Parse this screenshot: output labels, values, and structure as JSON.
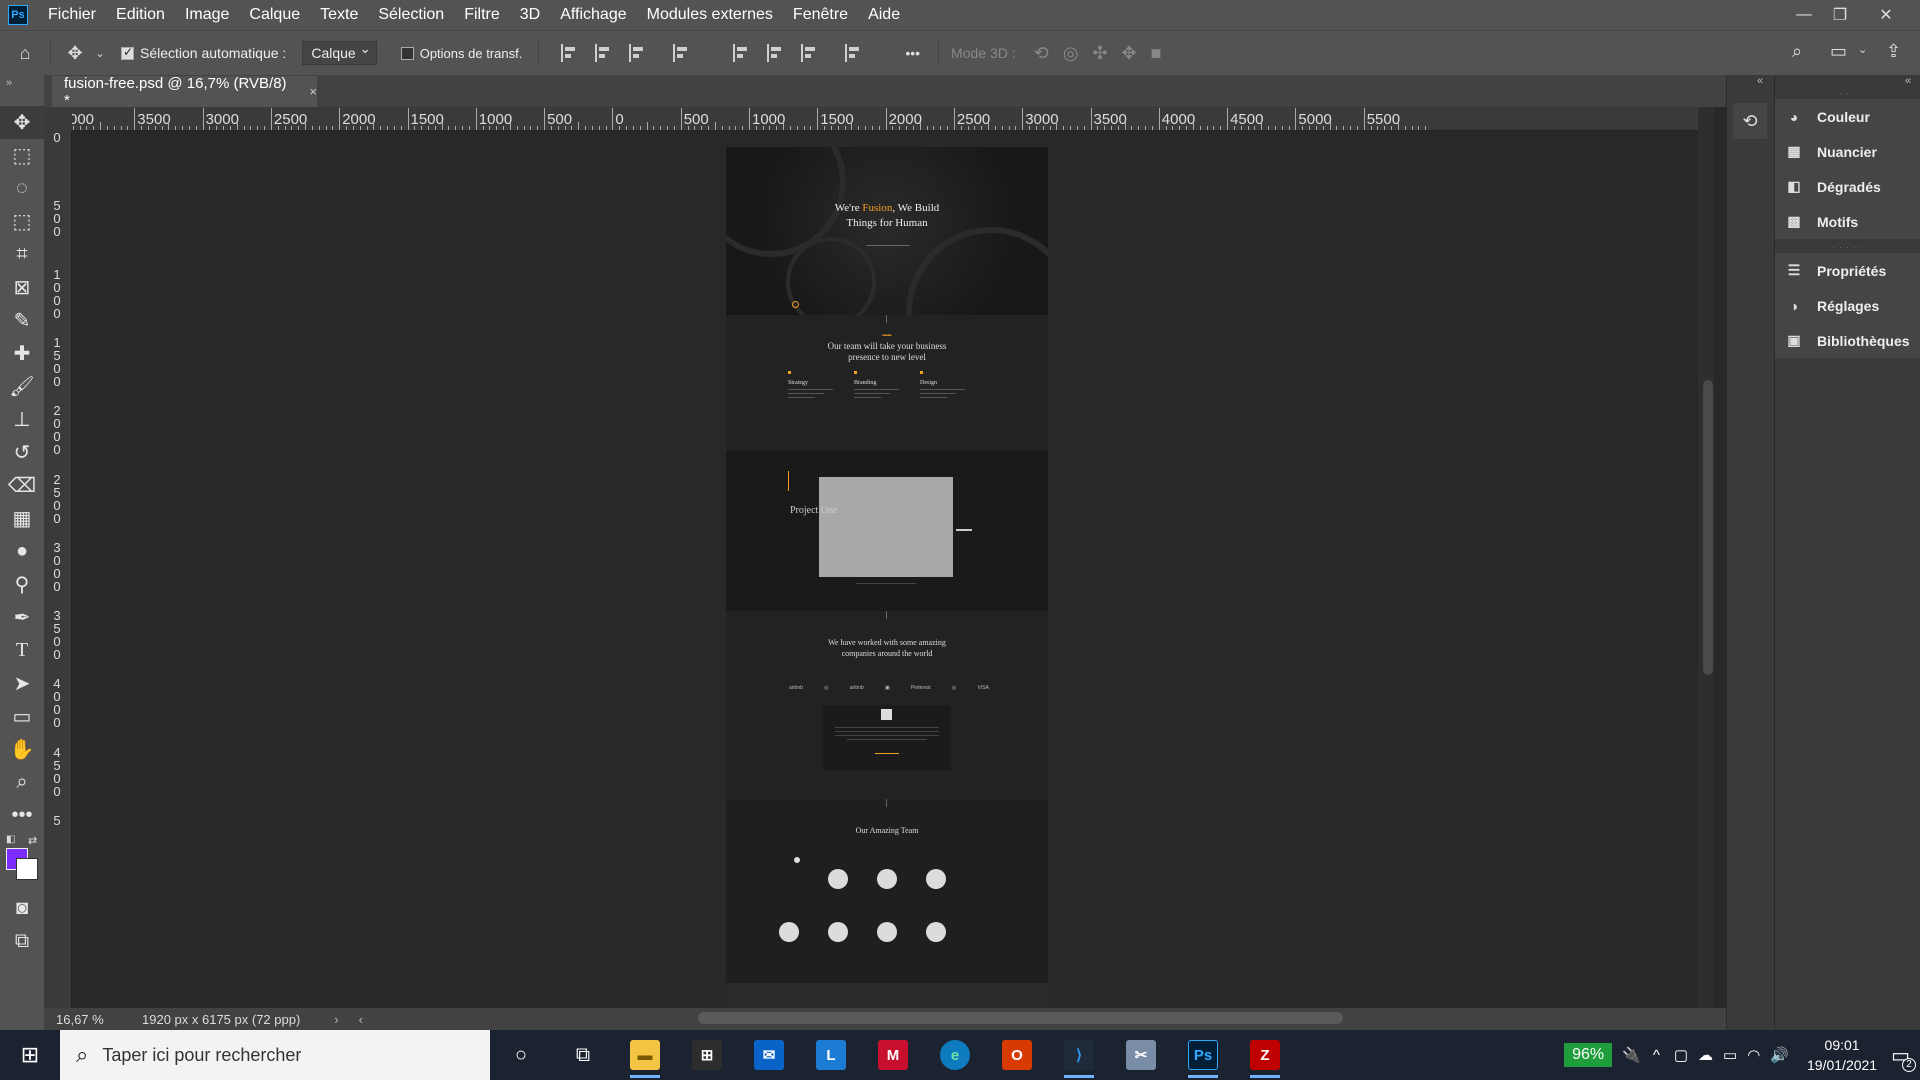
{
  "app": {
    "logo": "Ps"
  },
  "menu": [
    "Fichier",
    "Edition",
    "Image",
    "Calque",
    "Texte",
    "Sélection",
    "Filtre",
    "3D",
    "Affichage",
    "Modules externes",
    "Fenêtre",
    "Aide"
  ],
  "window_controls": {
    "minimize": "—",
    "restore": "❐",
    "close": "✕"
  },
  "options": {
    "auto_select_label": "Sélection automatique :",
    "auto_select_checked": true,
    "layer_select": "Calque",
    "transform_label": "Options de transf.",
    "mode3d_label": "Mode 3D :",
    "more": "•••"
  },
  "document": {
    "tab_title": "fusion-free.psd @ 16,7% (RVB/8) *",
    "close": "×",
    "zoom": "16,67 %",
    "size": "1920 px x 6175 px (72 ppp)"
  },
  "ruler": {
    "h_labels": [
      "000",
      "3500",
      "3000",
      "2500",
      "2000",
      "1500",
      "1000",
      "500",
      "0",
      "500",
      "1000",
      "1500",
      "2000",
      "2500",
      "3000",
      "3500",
      "4000",
      "4500",
      "5000",
      "5500"
    ],
    "v_labels": [
      "0",
      "500",
      "1000",
      "1500",
      "2000",
      "2500",
      "3000",
      "3500",
      "4000",
      "4500",
      "5"
    ]
  },
  "canvas": {
    "hero_title_pre": "We're ",
    "hero_title_accent": "Fusion",
    "hero_title_post": ", We Build",
    "hero_title_line2": "Things for Human",
    "services_title_1": "Our team will take your business",
    "services_title_2": "presence to new level",
    "services": [
      "Strategy",
      "Branding",
      "Design"
    ],
    "project_title": "Project One",
    "clients_title_1": "We have worked with some amazing",
    "clients_title_2": "companies around the world",
    "client_logos": [
      "airbnb",
      "◎",
      "airbnb",
      "▣",
      "Pinterest",
      "◎",
      "VISA"
    ],
    "team_title": "Our Amazing Team"
  },
  "panels": {
    "group1": [
      "Couleur",
      "Nuancier",
      "Dégradés",
      "Motifs"
    ],
    "group2": [
      "Propriétés",
      "Réglages",
      "Bibliothèques"
    ]
  },
  "taskbar": {
    "search_placeholder": "Taper ici pour rechercher",
    "battery": "96%",
    "time": "09:01",
    "date": "19/01/2021",
    "notifications": "2"
  },
  "colors": {
    "foreground": "#7b2cff",
    "background": "#ffffff",
    "accent": "#f0a020"
  }
}
